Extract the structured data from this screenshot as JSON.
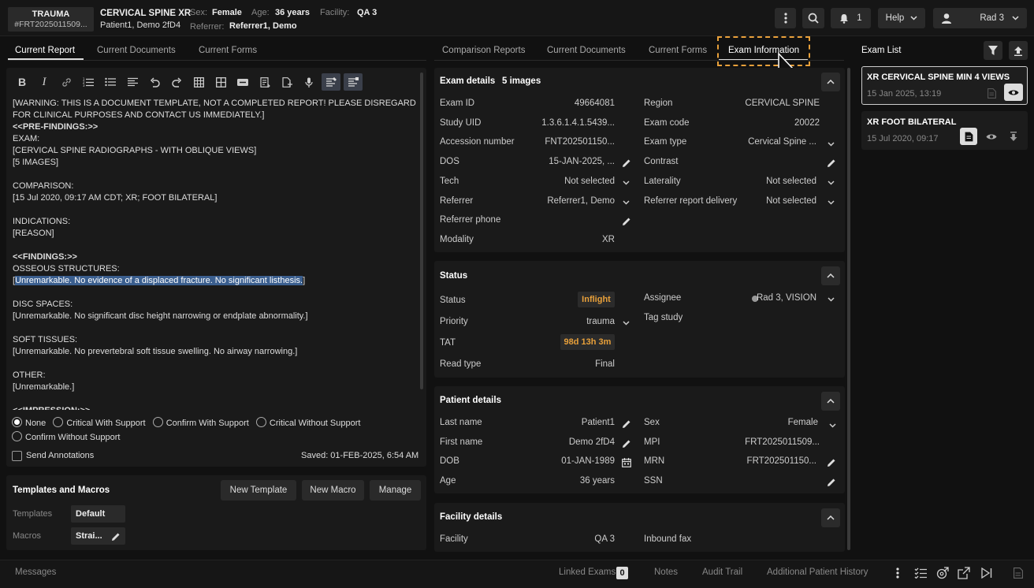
{
  "header": {
    "badge_title": "TRAUMA",
    "badge_id": "#FRT2025011509...",
    "exam_title": "CERVICAL SPINE XR",
    "patient": "Patient1, Demo 2fD4",
    "sex_label": "Sex:",
    "sex": "Female",
    "age_label": "Age:",
    "age": "36 years",
    "facility_label": "Facility:",
    "facility": "QA 3",
    "referrer_label": "Referrer:",
    "referrer": "Referrer1, Demo",
    "notif_count": "1",
    "help_label": "Help",
    "user_label": "Rad 3"
  },
  "left_tabs": [
    "Current Report",
    "Current Documents",
    "Current Forms"
  ],
  "mid_tabs": [
    "Comparison Reports",
    "Current Documents",
    "Current Forms",
    "Exam Information"
  ],
  "report": {
    "lines": [
      "[WARNING: THIS IS A DOCUMENT TEMPLATE, NOT A COMPLETED REPORT! PLEASE DISREGARD",
      "FOR CLINICAL PURPOSES AND CONTACT US IMMEDIATELY.]",
      "<<PRE-FINDINGS:>>",
      "EXAM:",
      "[CERVICAL SPINE RADIOGRAPHS - WITH OBLIQUE VIEWS]",
      "[5 IMAGES]",
      "",
      "COMPARISON:",
      "[15 Jul 2020, 09:17 AM CDT; XR; FOOT BILATERAL]",
      "",
      "INDICATIONS:",
      "[REASON]",
      "",
      "<<FINDINGS:>>",
      "OSSEOUS STRUCTURES:",
      "",
      "",
      "DISC SPACES:",
      "[Unremarkable. No significant disc height narrowing or endplate abnormality.]",
      "",
      "SOFT TISSUES:",
      "[Unremarkable. No prevertebral soft tissue swelling. No airway narrowing.]",
      "",
      "OTHER:",
      "[Unremarkable.]",
      "",
      "<<IMPRESSION:>>"
    ],
    "highlight_prefix": "[",
    "highlight_text": "Unremarkable. No evidence of a displaced fracture. No significant listhesis.",
    "highlight_suffix": "]",
    "radios": [
      "None",
      "Critical With Support",
      "Confirm With Support",
      "Critical Without Support",
      "Confirm Without Support"
    ],
    "send_annotations": "Send Annotations",
    "saved": "Saved: 01-FEB-2025, 6:54 AM"
  },
  "templates": {
    "title": "Templates and Macros",
    "new_template": "New Template",
    "new_macro": "New Macro",
    "manage": "Manage",
    "templates_label": "Templates",
    "templates_value": "Default",
    "macros_label": "Macros",
    "macros_value": "Strai..."
  },
  "exam_details": {
    "title": "Exam details",
    "images": "5 images",
    "left": [
      {
        "label": "Exam ID",
        "value": "49664081"
      },
      {
        "label": "Study UID",
        "value": "1.3.6.1.4.1.5439..."
      },
      {
        "label": "Accession number",
        "value": "FNT202501150..."
      },
      {
        "label": "DOS",
        "value": "15-JAN-2025, ..."
      },
      {
        "label": "Tech",
        "value": "Not selected"
      },
      {
        "label": "Referrer",
        "value": "Referrer1, Demo"
      },
      {
        "label": "Referrer phone",
        "value": ""
      },
      {
        "label": "Modality",
        "value": "XR"
      }
    ],
    "right": [
      {
        "label": "Region",
        "value": "CERVICAL SPINE"
      },
      {
        "label": "Exam code",
        "value": "20022"
      },
      {
        "label": "Exam type",
        "value": "Cervical Spine ..."
      },
      {
        "label": "Contrast",
        "value": ""
      },
      {
        "label": "Laterality",
        "value": "Not selected"
      },
      {
        "label": "Referrer report delivery",
        "value": "Not selected"
      }
    ]
  },
  "status": {
    "title": "Status",
    "status_label": "Status",
    "status_value": "Inflight",
    "priority_label": "Priority",
    "priority_value": "trauma",
    "tat_label": "TAT",
    "tat_value": "98d 13h 3m",
    "read_type_label": "Read type",
    "read_type_value": "Final",
    "assignee_label": "Assignee",
    "assignee_value": "Rad 3, VISION",
    "tag_study_label": "Tag study",
    "accent": "#e8a03a"
  },
  "patient_details": {
    "title": "Patient details",
    "left": [
      {
        "label": "Last name",
        "value": "Patient1"
      },
      {
        "label": "First name",
        "value": "Demo 2fD4"
      },
      {
        "label": "DOB",
        "value": "01-JAN-1989"
      },
      {
        "label": "Age",
        "value": "36 years"
      }
    ],
    "right": [
      {
        "label": "Sex",
        "value": "Female"
      },
      {
        "label": "MPI",
        "value": "FRT2025011509..."
      },
      {
        "label": "MRN",
        "value": "FRT202501150..."
      },
      {
        "label": "SSN",
        "value": ""
      }
    ]
  },
  "facility_details": {
    "title": "Facility details",
    "facility_label": "Facility",
    "facility_value": "QA 3",
    "inbound_fax_label": "Inbound fax"
  },
  "exam_list": {
    "title": "Exam List",
    "items": [
      {
        "title": "XR CERVICAL SPINE MIN 4 VIEWS",
        "date": "15 Jan 2025, 13:19"
      },
      {
        "title": "XR FOOT BILATERAL",
        "date": "15 Jul 2020, 09:17"
      }
    ]
  },
  "footer": {
    "messages": "Messages",
    "linked_exams": "Linked Exams",
    "linked_count": "0",
    "notes": "Notes",
    "audit_trail": "Audit Trail",
    "additional_history": "Additional Patient History"
  }
}
